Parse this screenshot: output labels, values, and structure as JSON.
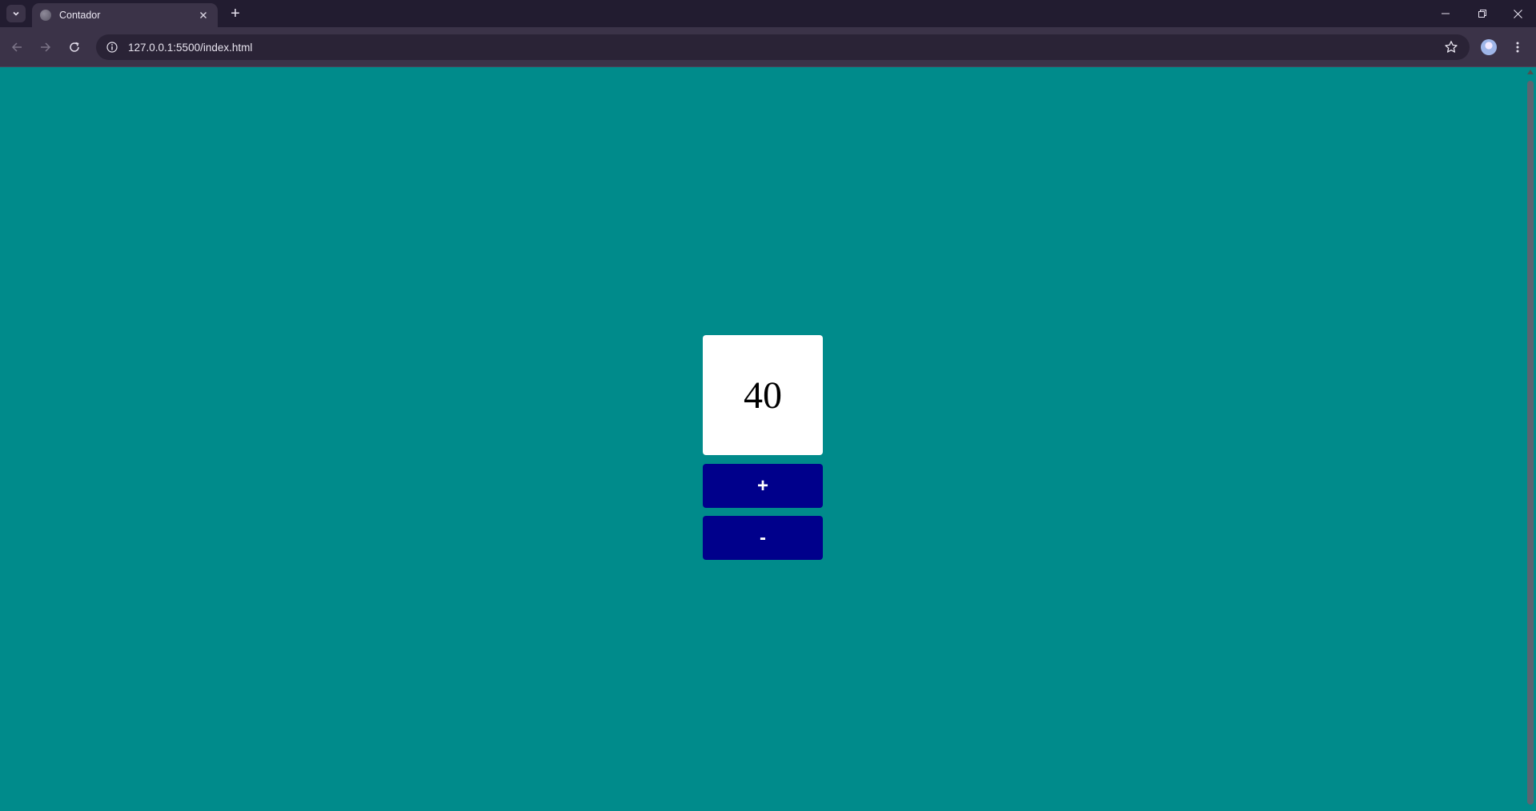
{
  "browser": {
    "tab": {
      "title": "Contador"
    },
    "new_tab_label": "+",
    "url": "127.0.0.1:5500/index.html"
  },
  "icons": {
    "tab_search": "chevron-down-icon",
    "favicon": "globe-icon",
    "tab_close": "close-icon",
    "minimize": "minimize-icon",
    "maximize": "restore-icon",
    "window_close": "close-icon",
    "back": "arrow-left-icon",
    "forward": "arrow-right-icon",
    "reload": "reload-icon",
    "site_info": "info-icon",
    "bookmark": "star-icon",
    "profile": "avatar",
    "menu": "kebab-menu-icon"
  },
  "page": {
    "counter_value": "40",
    "increment_label": "+",
    "decrement_label": "-"
  },
  "colors": {
    "page_background": "#008b8b",
    "button_background": "#00008b",
    "display_background": "#ffffff"
  }
}
